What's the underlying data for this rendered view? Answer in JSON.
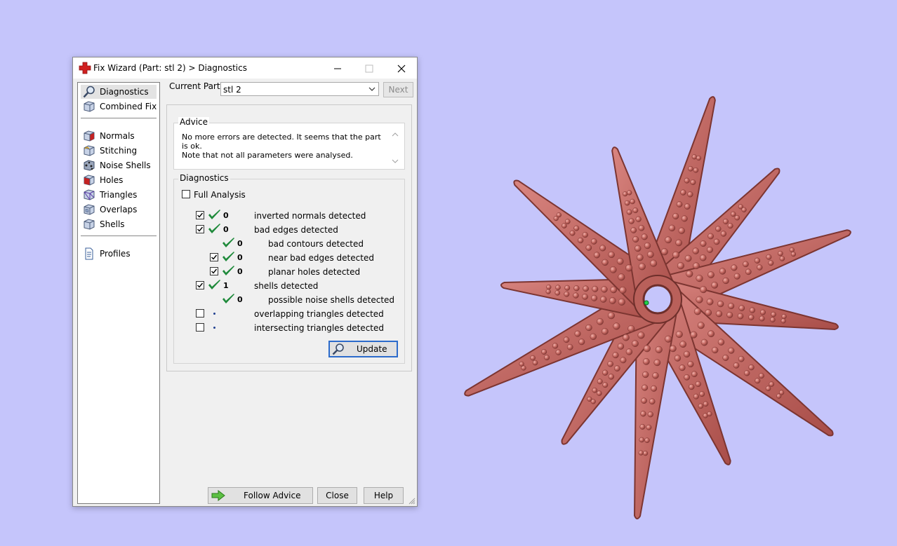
{
  "window": {
    "title": "Fix Wizard (Part: stl 2) > Diagnostics",
    "min_icon": "minimize-icon",
    "max_icon": "maximize-icon",
    "close_icon": "close-icon"
  },
  "sidebar": {
    "items": [
      {
        "label": "Diagnostics",
        "icon": "magnifier-icon",
        "selected": true
      },
      {
        "label": "Combined Fix",
        "icon": "combined-fix-cube-icon"
      },
      {
        "label": "Normals",
        "icon": "normals-cube-icon"
      },
      {
        "label": "Stitching",
        "icon": "stitching-cube-icon"
      },
      {
        "label": "Noise Shells",
        "icon": "noise-shells-cube-icon"
      },
      {
        "label": "Holes",
        "icon": "holes-cube-icon"
      },
      {
        "label": "Triangles",
        "icon": "triangles-cube-icon"
      },
      {
        "label": "Overlaps",
        "icon": "overlaps-cube-icon"
      },
      {
        "label": "Shells",
        "icon": "shells-cube-icon"
      },
      {
        "label": "Profiles",
        "icon": "profile-document-icon"
      }
    ]
  },
  "current_part": {
    "label": "Current Part:",
    "value": "stl 2",
    "next_label": "Next"
  },
  "advice": {
    "title": "Advice",
    "text_line1": "No more errors are detected. It seems that the part is ok.",
    "text_line2": "Note that not all parameters were analysed."
  },
  "diagnostics": {
    "title": "Diagnostics",
    "full_analysis_label": "Full Analysis",
    "full_analysis_checked": false,
    "rows": [
      {
        "checkbox": true,
        "checked": true,
        "status": "ok",
        "count": "0",
        "label": "inverted normals detected",
        "indent": 0
      },
      {
        "checkbox": true,
        "checked": true,
        "status": "ok",
        "count": "0",
        "label": "bad edges detected",
        "indent": 0
      },
      {
        "checkbox": false,
        "checked": false,
        "status": "ok",
        "count": "0",
        "label": "bad contours detected",
        "indent": 1
      },
      {
        "checkbox": true,
        "checked": true,
        "status": "ok",
        "count": "0",
        "label": "near bad edges detected",
        "indent": 1
      },
      {
        "checkbox": true,
        "checked": true,
        "status": "ok",
        "count": "0",
        "label": "planar holes detected",
        "indent": 1
      },
      {
        "checkbox": true,
        "checked": true,
        "status": "ok",
        "count": "1",
        "label": "shells detected",
        "indent": 0
      },
      {
        "checkbox": false,
        "checked": false,
        "status": "ok",
        "count": "0",
        "label": "possible noise shells detected",
        "indent": 1
      },
      {
        "checkbox": true,
        "checked": false,
        "status": "pending",
        "count": "",
        "label": "overlapping triangles detected",
        "indent": 0
      },
      {
        "checkbox": true,
        "checked": false,
        "status": "pending",
        "count": "",
        "label": "intersecting triangles detected",
        "indent": 0
      }
    ],
    "update_label": "Update"
  },
  "footer": {
    "follow_advice_label": "Follow Advice",
    "close_label": "Close",
    "help_label": "Help"
  },
  "colors": {
    "viewport_background": "#c5c5fb",
    "model": "#c0615c",
    "check_green": "#1f8a3b",
    "focus_border": "#2c6bcb"
  }
}
